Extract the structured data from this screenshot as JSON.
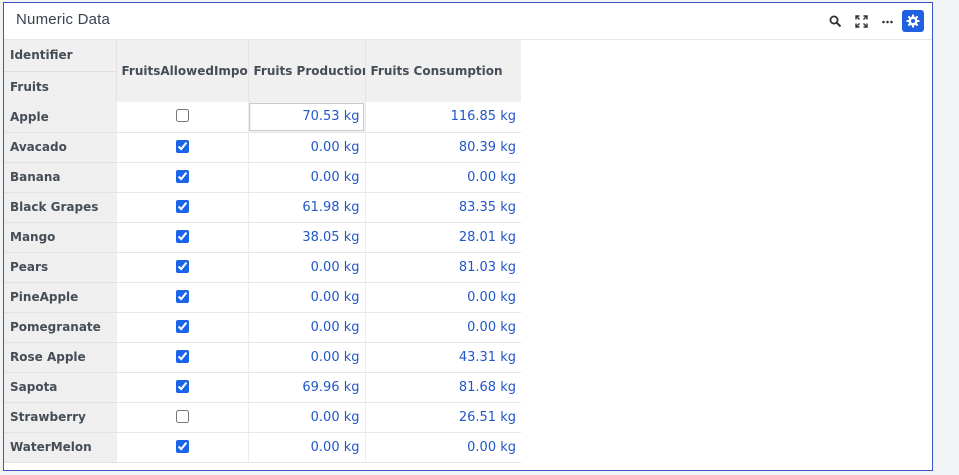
{
  "panel": {
    "title": "Numeric Data",
    "accent": "#1f5fe0",
    "toolbar": [
      "search-icon",
      "expand-icon",
      "more-icon",
      "settings-icon"
    ]
  },
  "table": {
    "row_header_label": "Identifier",
    "row_dimension_label": "Fruits",
    "columns": [
      "FruitsAllowedImport",
      "Fruits Production",
      "Fruits Consumption"
    ],
    "rows": [
      {
        "name": "Apple",
        "allowed": false,
        "production": "70.53 kg",
        "consumption": "116.85 kg"
      },
      {
        "name": "Avacado",
        "allowed": true,
        "production": "0.00 kg",
        "consumption": "80.39 kg"
      },
      {
        "name": "Banana",
        "allowed": true,
        "production": "0.00 kg",
        "consumption": "0.00 kg"
      },
      {
        "name": "Black Grapes",
        "allowed": true,
        "production": "61.98 kg",
        "consumption": "83.35 kg"
      },
      {
        "name": "Mango",
        "allowed": true,
        "production": "38.05 kg",
        "consumption": "28.01 kg"
      },
      {
        "name": "Pears",
        "allowed": true,
        "production": "0.00 kg",
        "consumption": "81.03 kg"
      },
      {
        "name": "PineApple",
        "allowed": true,
        "production": "0.00 kg",
        "consumption": "0.00 kg"
      },
      {
        "name": "Pomegranate",
        "allowed": true,
        "production": "0.00 kg",
        "consumption": "0.00 kg"
      },
      {
        "name": "Rose Apple",
        "allowed": true,
        "production": "0.00 kg",
        "consumption": "43.31 kg"
      },
      {
        "name": "Sapota",
        "allowed": true,
        "production": "69.96 kg",
        "consumption": "81.68 kg"
      },
      {
        "name": "Strawberry",
        "allowed": false,
        "production": "0.00 kg",
        "consumption": "26.51 kg"
      },
      {
        "name": "WaterMelon",
        "allowed": true,
        "production": "0.00 kg",
        "consumption": "0.00 kg"
      }
    ]
  }
}
